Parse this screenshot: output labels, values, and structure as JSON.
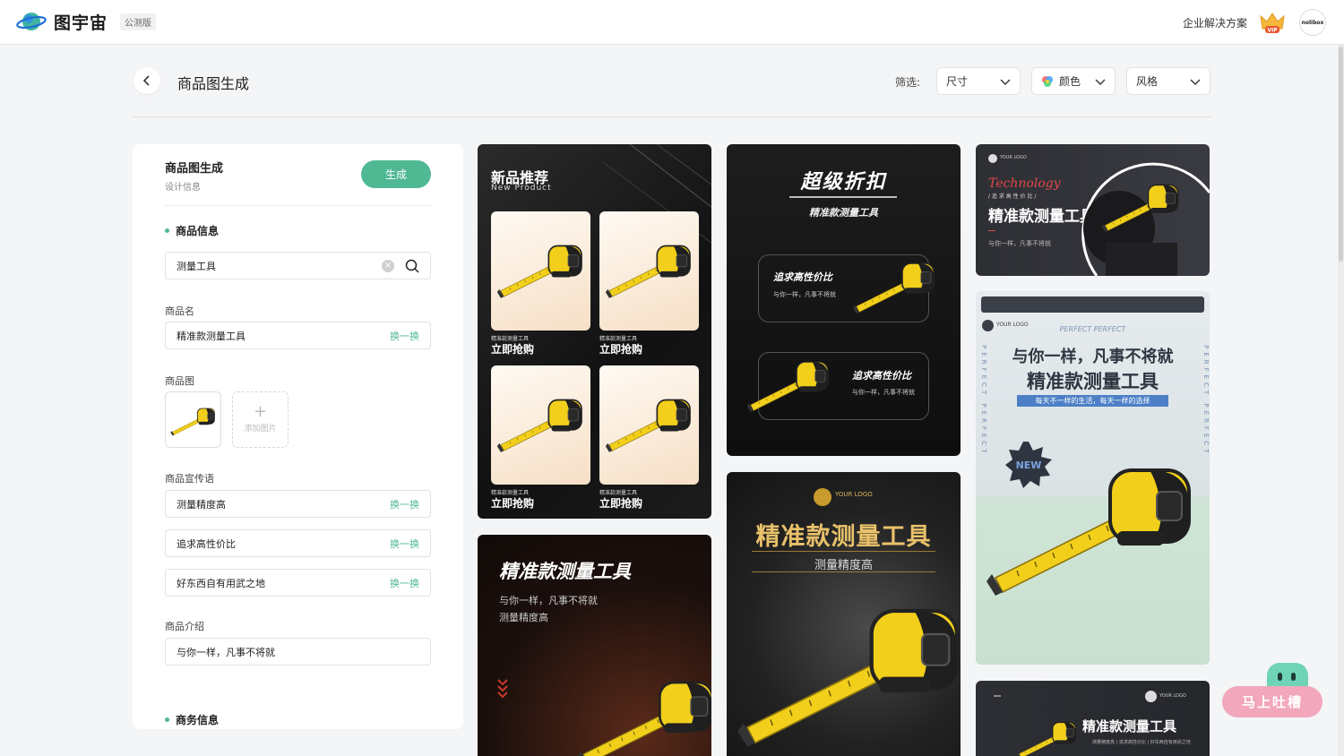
{
  "header": {
    "logo_text": "图宇宙",
    "beta_badge": "公测版",
    "enterprise_link": "企业解决方案",
    "vip_badge": "VIP",
    "avatar_text": "nolibox"
  },
  "page": {
    "title": "商品图生成",
    "filter_label": "筛选:",
    "filters": [
      {
        "label": "尺寸"
      },
      {
        "label": "颜色"
      },
      {
        "label": "风格"
      }
    ]
  },
  "panel": {
    "title": "商品图生成",
    "subtitle": "设计信息",
    "generate_label": "生成",
    "product_info_heading": "商品信息",
    "search_value": "测量工具",
    "name_label": "商品名",
    "name_value": "精准款测量工具",
    "swap_label": "换一换",
    "image_label": "商品图",
    "add_image_label": "添加图片",
    "slogan_label": "商品宣传语",
    "slogans": [
      "测量精度高",
      "追求高性价比",
      "好东西自有用武之地"
    ],
    "intro_label": "商品介绍",
    "intro_value": "与你一样，凡事不将就",
    "business_heading": "商务信息"
  },
  "cards": {
    "c1": {
      "title": "新品推荐",
      "subtitle": "New Product",
      "tiles": [
        {
          "small": "精准款测量工具",
          "big": "立即抢购"
        },
        {
          "small": "精准款测量工具",
          "big": "立即抢购"
        },
        {
          "small": "精准款测量工具",
          "big": "立即抢购"
        },
        {
          "small": "精准款测量工具",
          "big": "立即抢购"
        }
      ]
    },
    "c2": {
      "title": "精准款测量工具",
      "line1": "与你一样，凡事不将就",
      "line2": "测量精度高"
    },
    "c3": {
      "title": "超级折扣",
      "subtitle": "精准款测量工具",
      "box1_title": "追求高性价比",
      "box1_sub": "与你一样，凡事不将就",
      "box2_title": "追求高性价比",
      "box2_sub": "与你一样，凡事不将就"
    },
    "c4": {
      "logo": "YOUR LOGO",
      "title": "精准款测量工具",
      "subtitle": "测量精度高"
    },
    "c5": {
      "logo": "YOUR LOGO",
      "script": "Technology",
      "kicker": "/ 追 求 高 性 价 比 /",
      "title": "精准款测量工具",
      "sub": "与你一样，凡事不将就"
    },
    "c6": {
      "perfect": "PERFECT PERFECT",
      "logo": "YOUR LOGO",
      "line1": "与你一样，凡事不将就",
      "line2": "精准款测量工具",
      "banner": "每天不一样的生活，每天一样的选择",
      "new_badge": "NEW",
      "vertical": "PERFECT PERFECT"
    },
    "c7": {
      "logo": "YOUR LOGO",
      "title": "精准款测量工具",
      "sub": "测量精度高 | 追求高性价比 | 好东西自有用武之地"
    }
  },
  "feedback_button": "马上吐槽",
  "colors": {
    "accent": "#4fb993",
    "tape_yellow": "#f2cf1a"
  }
}
